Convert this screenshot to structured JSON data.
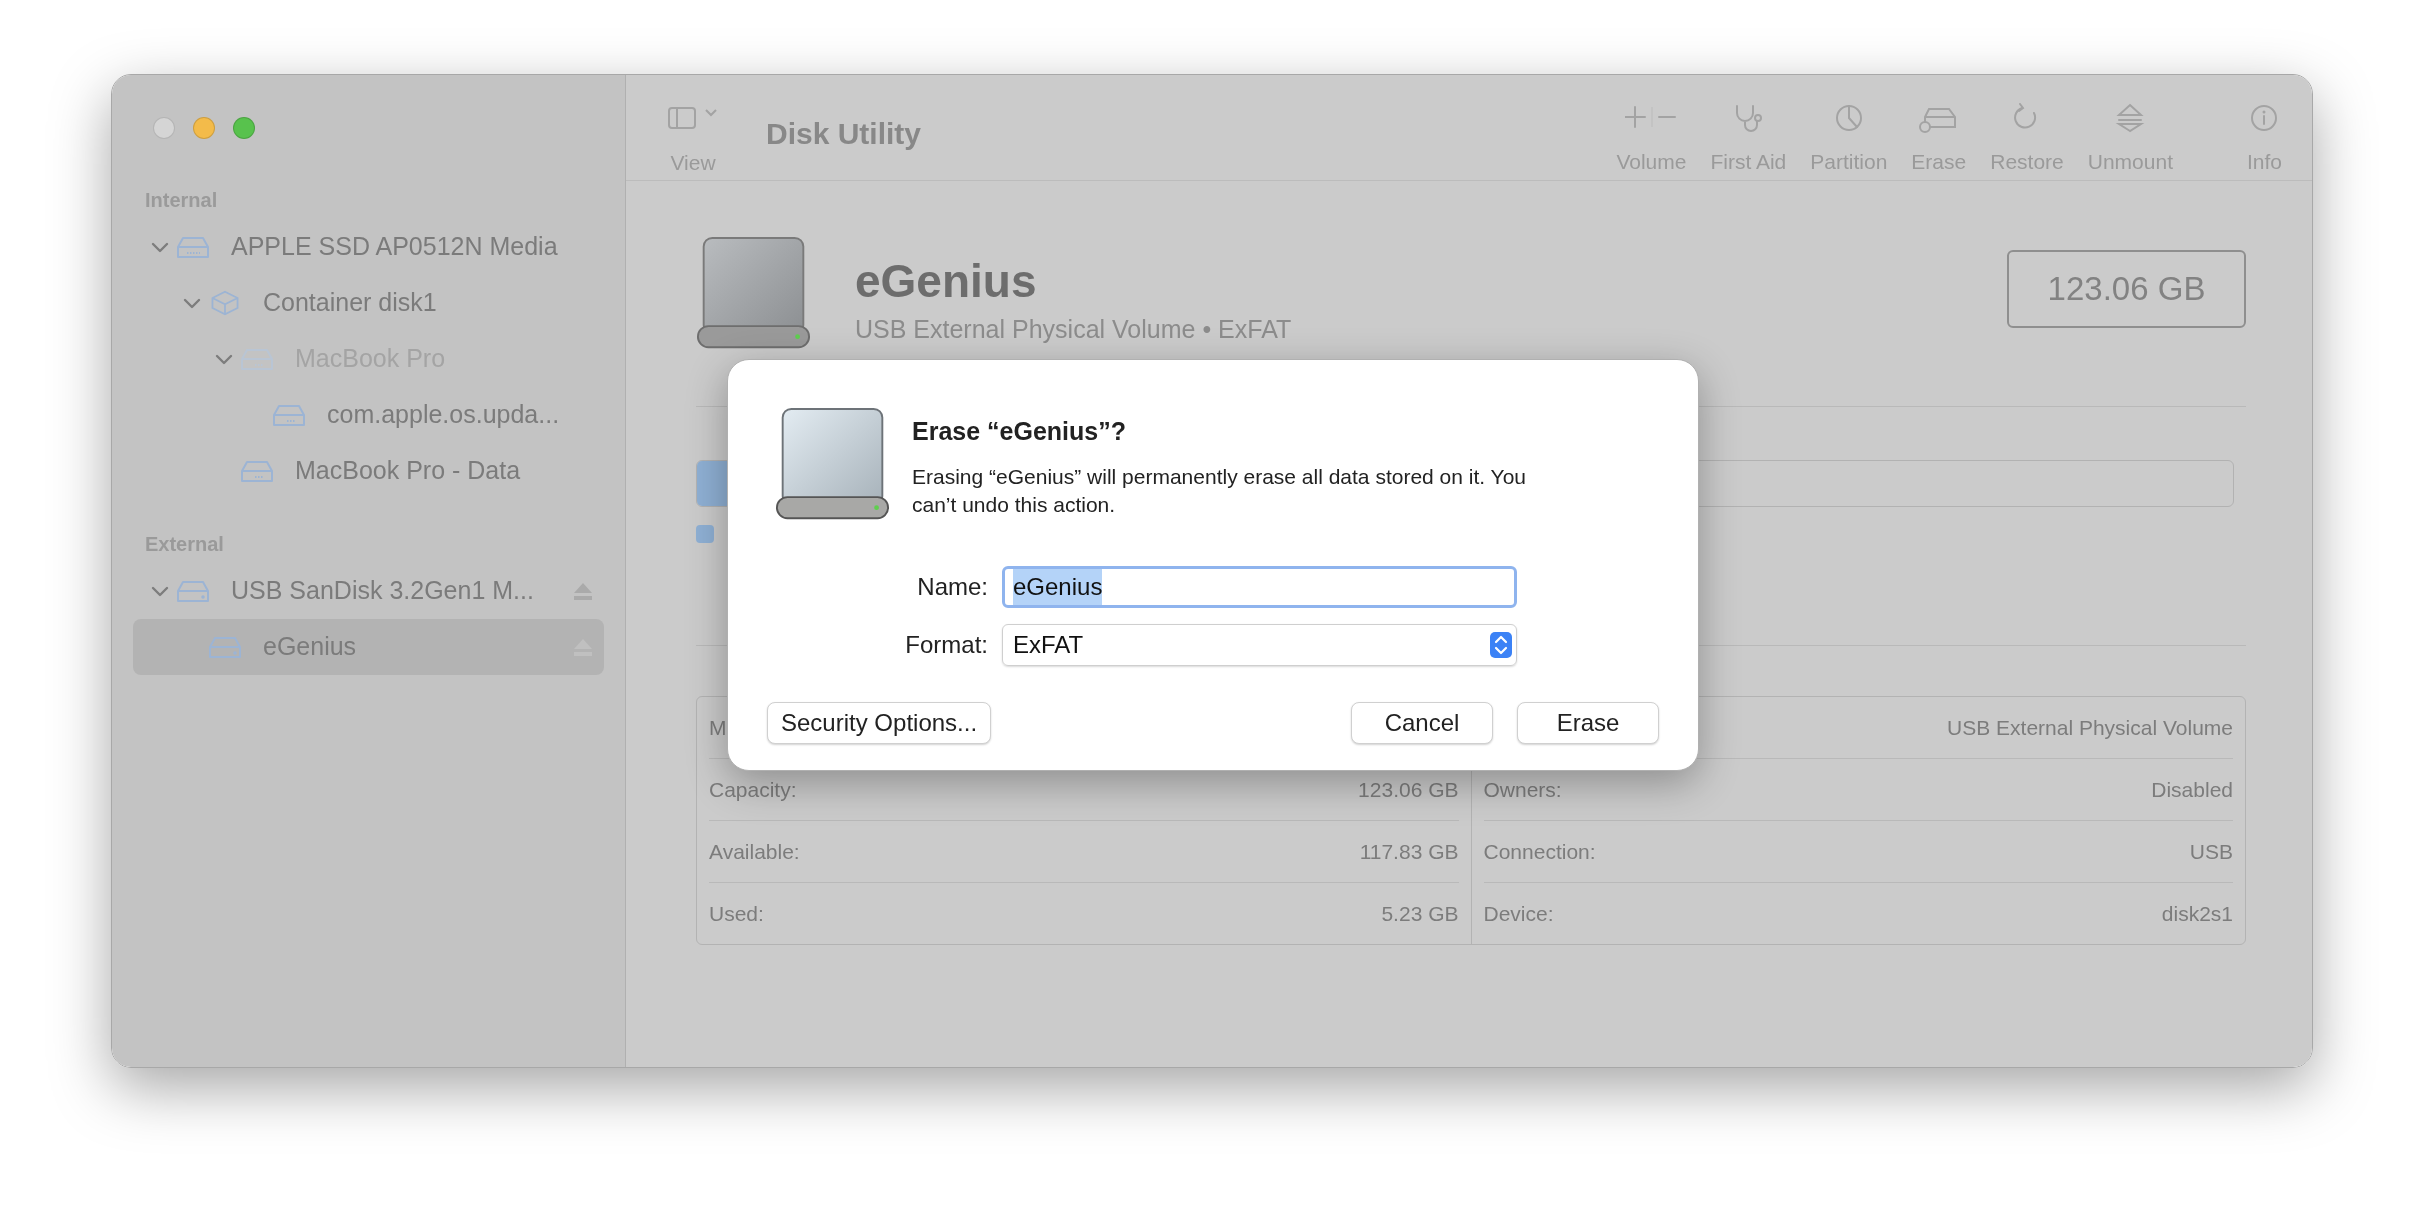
{
  "window": {
    "title": "Disk Utility",
    "traffic_lights": [
      {
        "color": "#d5d5d5"
      },
      {
        "color": "#f3bb4a"
      },
      {
        "color": "#58c24d"
      }
    ]
  },
  "toolbar": {
    "view": {
      "label": "View"
    },
    "buttons": [
      {
        "kind": "volume",
        "label": "Volume"
      },
      {
        "kind": "first_aid",
        "label": "First Aid"
      },
      {
        "kind": "partition",
        "label": "Partition"
      },
      {
        "kind": "erase",
        "label": "Erase"
      },
      {
        "kind": "restore",
        "label": "Restore"
      },
      {
        "kind": "unmount",
        "label": "Unmount"
      },
      {
        "kind": "info",
        "label": "Info"
      }
    ]
  },
  "sidebar": {
    "sections": [
      {
        "label": "Internal",
        "items": [
          {
            "label": "APPLE SSD AP0512N Media",
            "kind": "disk",
            "expanded": true,
            "mounted": true,
            "ejectable": false,
            "selected": false,
            "children": [
              {
                "label": "Container disk1",
                "kind": "container",
                "expanded": true,
                "mounted": true,
                "ejectable": false,
                "selected": false,
                "children": [
                  {
                    "label": "MacBook Pro",
                    "kind": "volume",
                    "expanded": true,
                    "mounted": false,
                    "ejectable": false,
                    "selected": false,
                    "children": [
                      {
                        "label": "com.apple.os.upda...",
                        "kind": "volume",
                        "mounted": true,
                        "ejectable": false,
                        "selected": false
                      }
                    ]
                  },
                  {
                    "label": "MacBook Pro - Data",
                    "kind": "volume",
                    "mounted": true,
                    "ejectable": false,
                    "selected": false
                  }
                ]
              }
            ]
          }
        ]
      },
      {
        "label": "External",
        "items": [
          {
            "label": "USB SanDisk 3.2Gen1 M...",
            "kind": "external",
            "expanded": true,
            "mounted": true,
            "ejectable": true,
            "selected": false,
            "children": [
              {
                "label": "eGenius",
                "kind": "external",
                "mounted": true,
                "ejectable": true,
                "selected": true
              }
            ]
          }
        ]
      }
    ]
  },
  "volume_header": {
    "name": "eGenius",
    "description": "USB External Physical Volume • ExFAT",
    "capacity": "123.06 GB"
  },
  "usage": {
    "level": 0.04
  },
  "info": {
    "left": [
      {
        "label": "M"
      },
      {
        "label": "Capacity:",
        "value": "123.06 GB"
      },
      {
        "label": "Available:",
        "value": "117.83 GB"
      },
      {
        "label": "Used:",
        "value": "5.23 GB"
      }
    ],
    "right": [
      {
        "value": "USB External Physical Volume"
      },
      {
        "label": "Owners:",
        "value": "Disabled"
      },
      {
        "label": "Connection:",
        "value": "USB"
      },
      {
        "label": "Device:",
        "value": "disk2s1"
      }
    ]
  },
  "dialog": {
    "title": "Erase “eGenius”?",
    "message": "Erasing “eGenius” will permanently erase all data stored on it. You can’t undo this action.",
    "fields": [
      {
        "kind": "text",
        "label": "Name:",
        "value": "eGenius",
        "text_selected": true
      },
      {
        "kind": "select",
        "label": "Format:",
        "value": "ExFAT"
      }
    ],
    "buttons": [
      {
        "kind": "option",
        "label": "Security Options..."
      },
      {
        "kind": "cancel",
        "label": "Cancel"
      },
      {
        "kind": "confirm",
        "label": "Erase"
      }
    ]
  }
}
